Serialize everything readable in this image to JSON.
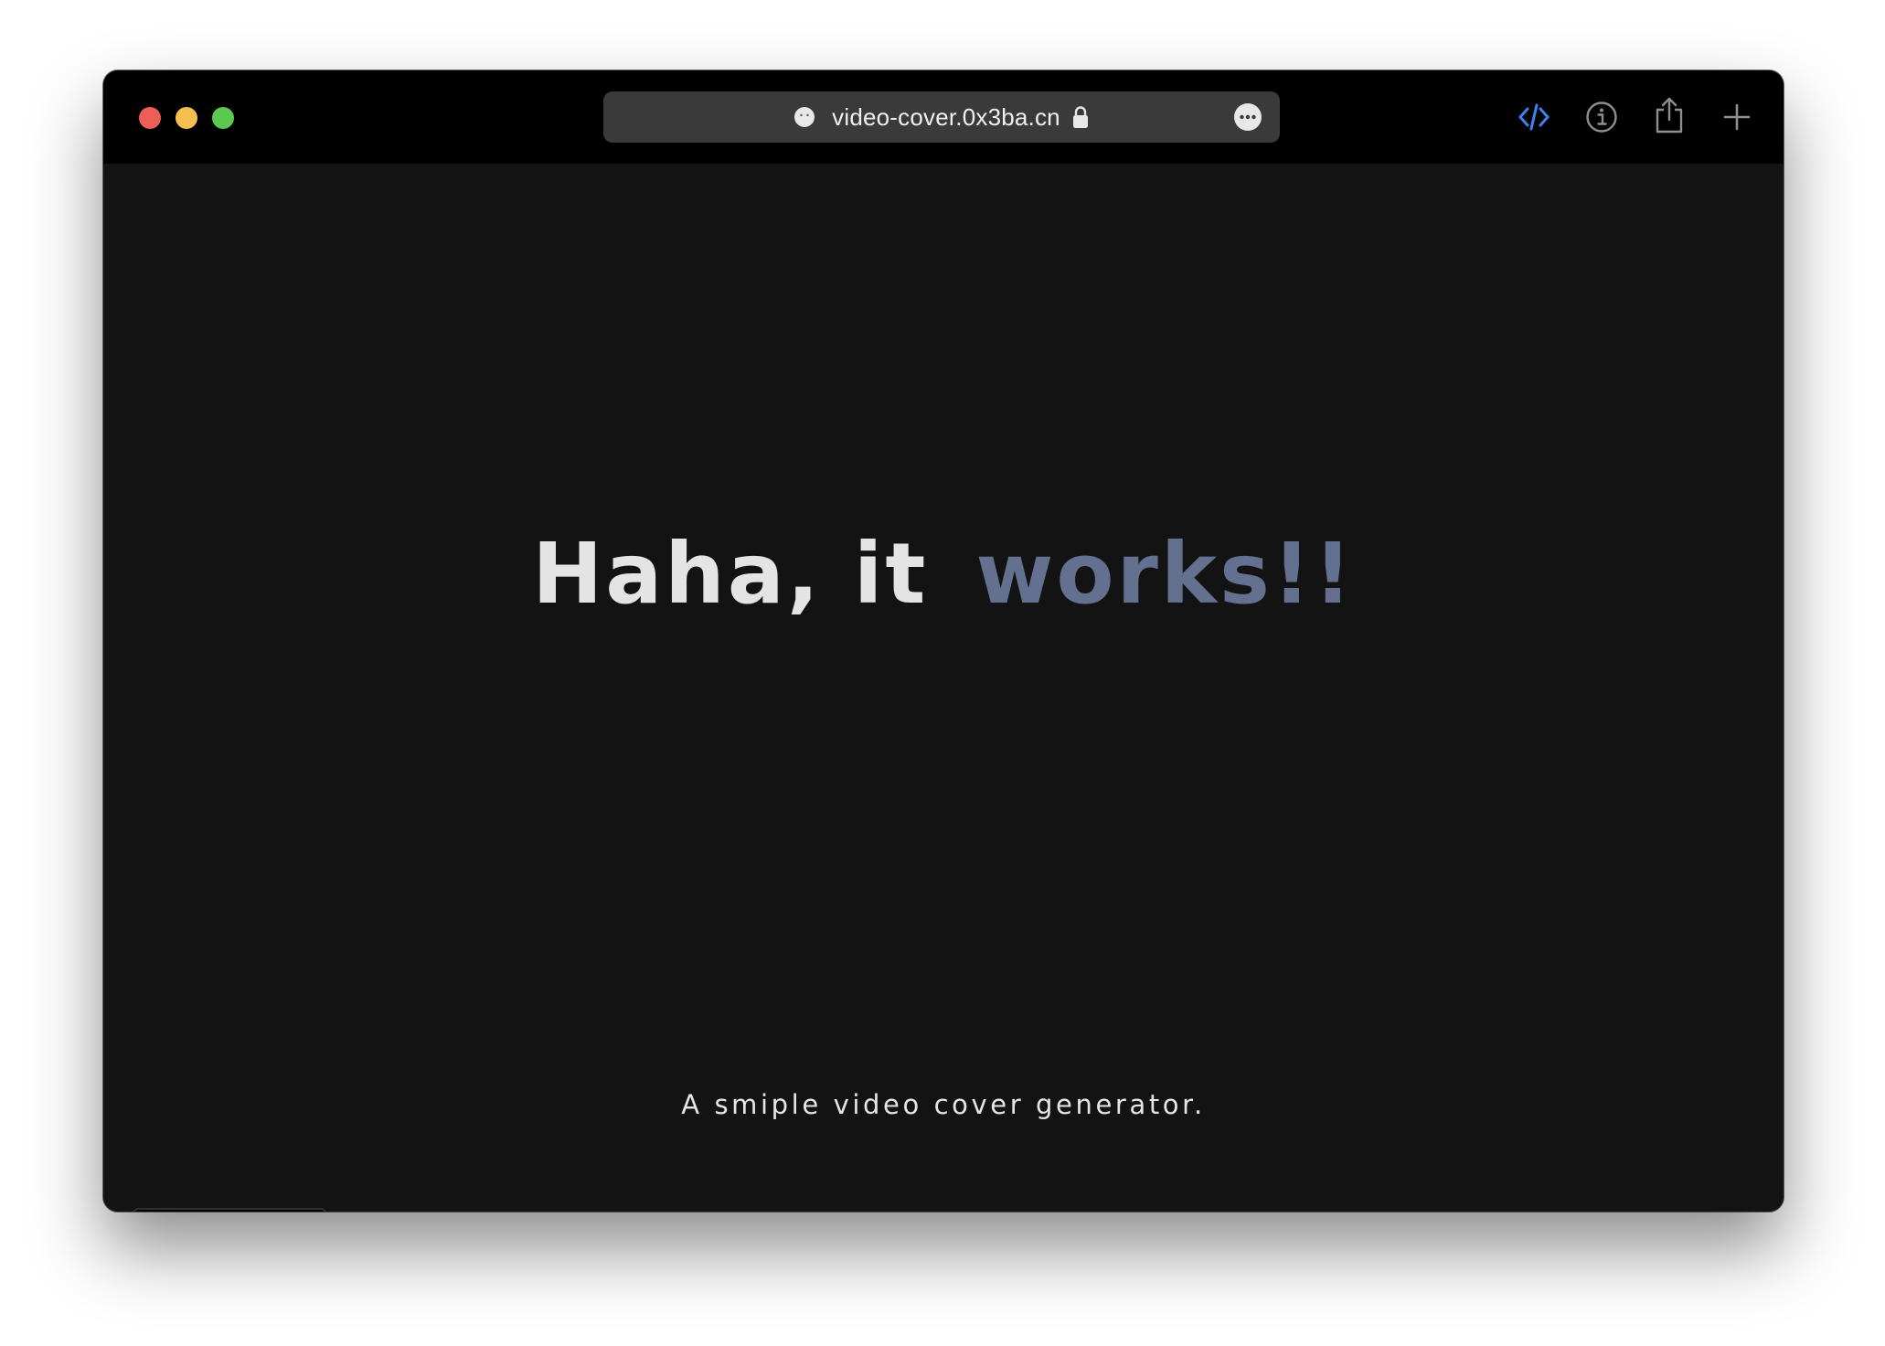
{
  "browser": {
    "url": "video-cover.0x3ba.cn",
    "icons": {
      "favicon": "favicon-icon",
      "lock": "lock-icon",
      "more": "more-icon",
      "code": "code-icon",
      "info": "info-icon",
      "share": "share-icon",
      "new_tab": "plus-icon"
    }
  },
  "cover": {
    "headline_part1": "Haha, it",
    "headline_part2": "works!!",
    "subtitle": "A smiple video cover generator.",
    "colors": {
      "background": "#131313",
      "headline": "#e4e4e4",
      "accent": "#64708f",
      "subtitle": "#e6e6e6"
    }
  },
  "toolbar": {
    "buttons": [
      {
        "name": "toggle-visibility",
        "icon": "closed-eye-icon"
      },
      {
        "name": "theme",
        "icon": "palette-icon"
      },
      {
        "name": "download",
        "icon": "download-icon"
      }
    ]
  }
}
